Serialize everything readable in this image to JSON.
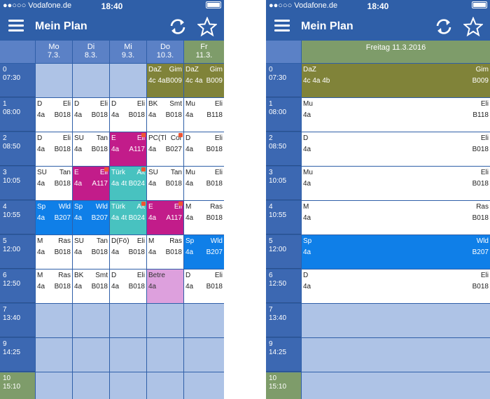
{
  "status": {
    "carrier": "●●○○○ Vodafone.de",
    "time": "18:40"
  },
  "app": {
    "title": "Mein Plan",
    "menu_icon": "menu-icon",
    "sync_icon": "sync-icon",
    "star_icon": "star-icon"
  },
  "colors": {
    "bar": "#2f5fa8",
    "empty": "#aec3e6",
    "today": "#7e9c6a",
    "olive": "#808339",
    "magenta": "#c21c8a",
    "teal": "#48c2c0",
    "blue": "#0f7fe8",
    "pink": "#dda0dd"
  },
  "periods": [
    {
      "num": "0",
      "time": "07:30"
    },
    {
      "num": "1",
      "time": "08:00"
    },
    {
      "num": "2",
      "time": "08:50"
    },
    {
      "num": "3",
      "time": "10:05"
    },
    {
      "num": "4",
      "time": "10:55"
    },
    {
      "num": "5",
      "time": "12:00"
    },
    {
      "num": "6",
      "time": "12:50"
    },
    {
      "num": "7",
      "time": "13:40"
    },
    {
      "num": "9",
      "time": "14:25"
    },
    {
      "num": "10",
      "time": "15:10"
    }
  ],
  "week": {
    "days": [
      {
        "name": "Mo",
        "date": "7.3."
      },
      {
        "name": "Di",
        "date": "8.3."
      },
      {
        "name": "Mi",
        "date": "9.3."
      },
      {
        "name": "Do",
        "date": "10.3."
      },
      {
        "name": "Fr",
        "date": "11.3."
      }
    ],
    "rows": [
      [
        null,
        null,
        null,
        {
          "tl": "DaZ",
          "tr": "Gim",
          "bl": "4c 4a",
          "br": "B009",
          "color": "olive"
        },
        {
          "tl": "DaZ",
          "tr": "Gim",
          "bl": "4c 4a",
          "br": "B009",
          "color": "olive"
        }
      ],
      [
        {
          "tl": "D",
          "tr": "Eli",
          "bl": "4a",
          "br": "B018"
        },
        {
          "tl": "D",
          "tr": "Eli",
          "bl": "4a",
          "br": "B018"
        },
        {
          "tl": "D",
          "tr": "Eli",
          "bl": "4a",
          "br": "B018"
        },
        {
          "tl": "BK",
          "tr": "Smt",
          "bl": "4a",
          "br": "B018"
        },
        {
          "tl": "Mu",
          "tr": "Eli",
          "bl": "4a",
          "br": "B118"
        }
      ],
      [
        {
          "tl": "D",
          "tr": "Eli",
          "bl": "4a",
          "br": "B018"
        },
        {
          "tl": "SU",
          "tr": "Tan",
          "bl": "4a",
          "br": "B018"
        },
        {
          "tl": "E",
          "tr": "Eli",
          "bl": "4a",
          "br": "A117",
          "color": "magenta",
          "flag": true
        },
        {
          "tl": "PC(Tl",
          "tr": "Cor",
          "bl": "4a",
          "br": "B027",
          "flag": true
        },
        {
          "tl": "D",
          "tr": "Eli",
          "bl": "4a",
          "br": "B018"
        }
      ],
      [
        {
          "tl": "SU",
          "tr": "Tan",
          "bl": "4a",
          "br": "B018"
        },
        {
          "tl": "E",
          "tr": "Eli",
          "bl": "4a",
          "br": "A117",
          "color": "magenta",
          "flag": true
        },
        {
          "tl": "Türk",
          "tr": "Alt",
          "bl": "4a 4t",
          "br": "B024",
          "color": "teal",
          "flag": true
        },
        {
          "tl": "SU",
          "tr": "Tan",
          "bl": "4a",
          "br": "B018"
        },
        {
          "tl": "Mu",
          "tr": "Eli",
          "bl": "4a",
          "br": "B018"
        }
      ],
      [
        {
          "tl": "Sp",
          "tr": "Wld",
          "bl": "4a",
          "br": "B207",
          "color": "blue"
        },
        {
          "tl": "Sp",
          "tr": "Wld",
          "bl": "4a",
          "br": "B207",
          "color": "blue"
        },
        {
          "tl": "Türk",
          "tr": "Alt",
          "bl": "4a 4t",
          "br": "B024",
          "color": "teal",
          "flag": true
        },
        {
          "tl": "E",
          "tr": "Eli",
          "bl": "4a",
          "br": "A117",
          "color": "magenta",
          "flag": true
        },
        {
          "tl": "M",
          "tr": "Ras",
          "bl": "4a",
          "br": "B018"
        }
      ],
      [
        {
          "tl": "M",
          "tr": "Ras",
          "bl": "4a",
          "br": "B018"
        },
        {
          "tl": "SU",
          "tr": "Tan",
          "bl": "4a",
          "br": "B018"
        },
        {
          "tl": "D(Fö)",
          "tr": "Eli",
          "bl": "4a",
          "br": "B018"
        },
        {
          "tl": "M",
          "tr": "Ras",
          "bl": "4a",
          "br": "B018"
        },
        {
          "tl": "Sp",
          "tr": "Wld",
          "bl": "4a",
          "br": "B207",
          "color": "blue"
        }
      ],
      [
        {
          "tl": "M",
          "tr": "Ras",
          "bl": "4a",
          "br": "B018"
        },
        {
          "tl": "BK",
          "tr": "Smt",
          "bl": "4a",
          "br": "B018"
        },
        {
          "tl": "D",
          "tr": "Eli",
          "bl": "4a",
          "br": "B018"
        },
        {
          "tl": "Betre",
          "tr": "",
          "bl": "4a",
          "br": "",
          "color": "pink"
        },
        {
          "tl": "D",
          "tr": "Eli",
          "bl": "4a",
          "br": "B018"
        }
      ],
      [
        null,
        null,
        null,
        null,
        null
      ],
      [
        null,
        null,
        null,
        null,
        null
      ],
      [
        null,
        null,
        null,
        null,
        null
      ]
    ]
  },
  "day": {
    "header": "Freitag  11.3.2016",
    "rows": [
      {
        "tl": "DaZ",
        "tr": "Gim",
        "bl": "4c 4a 4b",
        "br": "B009",
        "color": "olive"
      },
      {
        "tl": "Mu",
        "tr": "Eli",
        "bl": "4a",
        "br": "B118"
      },
      {
        "tl": "D",
        "tr": "Eli",
        "bl": "4a",
        "br": "B018"
      },
      {
        "tl": "Mu",
        "tr": "Eli",
        "bl": "4a",
        "br": "B018"
      },
      {
        "tl": "M",
        "tr": "Ras",
        "bl": "4a",
        "br": "B018"
      },
      {
        "tl": "Sp",
        "tr": "Wld",
        "bl": "4a",
        "br": "B207",
        "color": "blue"
      },
      {
        "tl": "D",
        "tr": "Eli",
        "bl": "4a",
        "br": "B018"
      },
      null,
      null,
      null
    ]
  }
}
